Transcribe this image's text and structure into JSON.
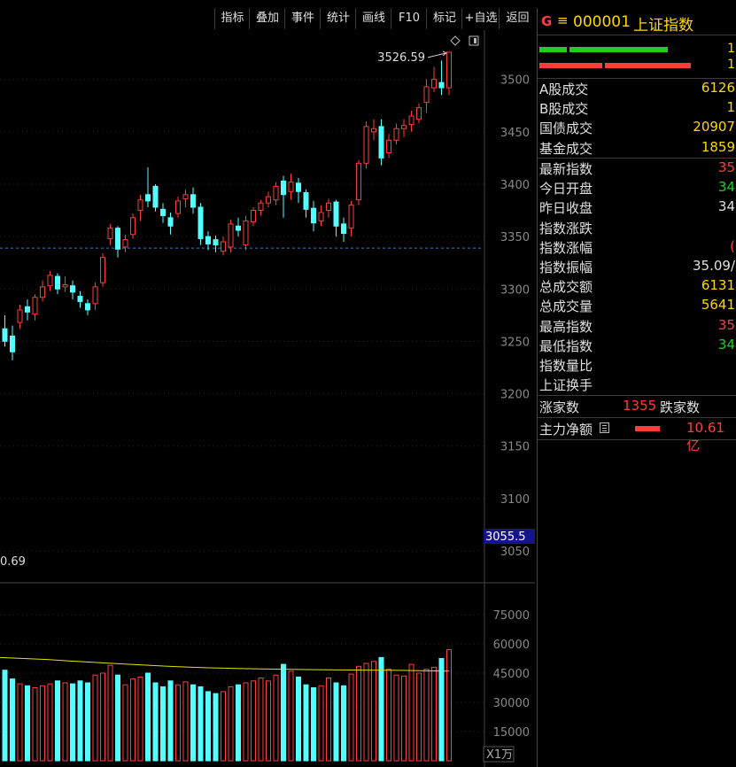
{
  "toolbar": {
    "buttons": [
      {
        "label": "指标"
      },
      {
        "label": "叠加"
      },
      {
        "label": "事件"
      },
      {
        "label": "统计"
      },
      {
        "label": "画线"
      },
      {
        "label": "F10"
      },
      {
        "label": "标记"
      },
      {
        "label": "+自选"
      },
      {
        "label": "返回"
      }
    ]
  },
  "header": {
    "badge": "G",
    "menu_glyph": "≡",
    "code": "000001",
    "name": "上证指数"
  },
  "colors": {
    "up": "#ff3d3d",
    "down": "#54ffff",
    "accent": "#ffd700",
    "green": "#22cc22",
    "ma": "#e3e300"
  },
  "side": {
    "top_digits": [
      "1",
      "1"
    ],
    "turnover": [
      {
        "label": "A股成交",
        "value": "6126",
        "color": "#ffd700"
      },
      {
        "label": "B股成交",
        "value": "1",
        "color": "#ffd700"
      },
      {
        "label": "国债成交",
        "value": "20907",
        "color": "#ffd700"
      },
      {
        "label": "基金成交",
        "value": "1859",
        "color": "#ffd700"
      }
    ],
    "index_info": [
      {
        "label": "最新指数",
        "value": "35",
        "color": "#ff3d3d"
      },
      {
        "label": "今日开盘",
        "value": "34",
        "color": "#22cc22"
      },
      {
        "label": "昨日收盘",
        "value": "34",
        "color": "#e0e0e0"
      },
      {
        "label": "指数涨跌",
        "value": "",
        "color": "#ff3d3d"
      },
      {
        "label": "指数涨幅",
        "value": "(",
        "color": "#ff3d3d"
      },
      {
        "label": "指数振幅",
        "value": "35.09/",
        "color": "#e0e0e0"
      },
      {
        "label": "总成交额",
        "value": "6131",
        "color": "#ffd700"
      },
      {
        "label": "总成交量",
        "value": "5641",
        "color": "#ffd700"
      },
      {
        "label": "最高指数",
        "value": "35",
        "color": "#ff3d3d"
      },
      {
        "label": "最低指数",
        "value": "34",
        "color": "#22cc22"
      },
      {
        "label": "指数量比",
        "value": "",
        "color": "#e0e0e0"
      },
      {
        "label": "上证换手",
        "value": "",
        "color": "#e0e0e0"
      }
    ],
    "breadth": {
      "up_label": "涨家数",
      "up_count": "1355",
      "down_label": "跌家数"
    },
    "mainforce": {
      "label": "主力净额",
      "value": "10.61亿"
    }
  },
  "chart_data": {
    "type": "candlestick",
    "y_axis": {
      "ticks": [
        3050,
        3100,
        3150,
        3200,
        3250,
        3300,
        3350,
        3400,
        3450,
        3500
      ]
    },
    "price_marker": "3055.5",
    "reference_line": 3339,
    "high_annotation": "3526.59",
    "low_annotation_fragment": "0.69",
    "volume_axis": {
      "unit_label": "X1万",
      "ticks": [
        15000,
        30000,
        45000,
        60000,
        75000
      ]
    },
    "candles": [
      [
        3262,
        3250,
        3275,
        3245
      ],
      [
        3255,
        3240,
        3265,
        3232
      ],
      [
        3268,
        3280,
        3285,
        3262
      ],
      [
        3283,
        3278,
        3290,
        3270
      ],
      [
        3276,
        3292,
        3295,
        3270
      ],
      [
        3292,
        3302,
        3308,
        3288
      ],
      [
        3303,
        3313,
        3317,
        3298
      ],
      [
        3312,
        3300,
        3315,
        3295
      ],
      [
        3302,
        3304,
        3312,
        3297
      ],
      [
        3303,
        3297,
        3308,
        3290
      ],
      [
        3293,
        3288,
        3298,
        3282
      ],
      [
        3286,
        3280,
        3290,
        3275
      ],
      [
        3286,
        3302,
        3306,
        3280
      ],
      [
        3306,
        3330,
        3334,
        3302
      ],
      [
        3348,
        3358,
        3362,
        3342
      ],
      [
        3358,
        3338,
        3360,
        3330
      ],
      [
        3340,
        3347,
        3352,
        3335
      ],
      [
        3352,
        3368,
        3372,
        3348
      ],
      [
        3375,
        3385,
        3390,
        3365
      ],
      [
        3390,
        3384,
        3416,
        3378
      ],
      [
        3398,
        3378,
        3400,
        3374
      ],
      [
        3376,
        3370,
        3382,
        3363
      ],
      [
        3368,
        3360,
        3373,
        3352
      ],
      [
        3372,
        3384,
        3388,
        3368
      ],
      [
        3386,
        3390,
        3395,
        3378
      ],
      [
        3390,
        3378,
        3397,
        3372
      ],
      [
        3378,
        3348,
        3382,
        3342
      ],
      [
        3350,
        3343,
        3355,
        3337
      ],
      [
        3347,
        3342,
        3351,
        3335
      ],
      [
        3336,
        3345,
        3350,
        3332
      ],
      [
        3340,
        3362,
        3366,
        3335
      ],
      [
        3360,
        3356,
        3368,
        3350
      ],
      [
        3342,
        3365,
        3370,
        3337
      ],
      [
        3364,
        3375,
        3378,
        3360
      ],
      [
        3375,
        3382,
        3385,
        3370
      ],
      [
        3382,
        3388,
        3393,
        3378
      ],
      [
        3385,
        3398,
        3402,
        3380
      ],
      [
        3403,
        3390,
        3408,
        3368
      ],
      [
        3393,
        3402,
        3410,
        3385
      ],
      [
        3401,
        3393,
        3406,
        3382
      ],
      [
        3392,
        3376,
        3395,
        3368
      ],
      [
        3377,
        3363,
        3384,
        3355
      ],
      [
        3365,
        3373,
        3380,
        3360
      ],
      [
        3375,
        3382,
        3386,
        3368
      ],
      [
        3383,
        3360,
        3385,
        3350
      ],
      [
        3362,
        3353,
        3368,
        3345
      ],
      [
        3358,
        3380,
        3384,
        3350
      ],
      [
        3385,
        3420,
        3423,
        3380
      ],
      [
        3420,
        3455,
        3460,
        3415
      ],
      [
        3450,
        3453,
        3462,
        3442
      ],
      [
        3455,
        3425,
        3462,
        3418
      ],
      [
        3430,
        3442,
        3448,
        3425
      ],
      [
        3442,
        3453,
        3458,
        3438
      ],
      [
        3453,
        3456,
        3462,
        3445
      ],
      [
        3457,
        3465,
        3470,
        3450
      ],
      [
        3462,
        3473,
        3477,
        3458
      ],
      [
        3478,
        3493,
        3500,
        3468
      ],
      [
        3492,
        3500,
        3512,
        3488
      ],
      [
        3497,
        3492,
        3518,
        3485
      ],
      [
        3492,
        3526,
        3526,
        3485
      ]
    ],
    "volumes": [
      46500,
      42000,
      39500,
      38500,
      37500,
      38500,
      39500,
      41000,
      40000,
      39500,
      41000,
      40000,
      44000,
      45000,
      49000,
      44000,
      39000,
      42000,
      43000,
      45000,
      40000,
      38000,
      41000,
      39000,
      40500,
      39000,
      38000,
      35500,
      34500,
      35500,
      38000,
      39000,
      40000,
      41000,
      42500,
      41000,
      44000,
      49500,
      46000,
      43000,
      39000,
      37500,
      38500,
      42500,
      40000,
      38500,
      44500,
      48500,
      50000,
      51000,
      53000,
      47000,
      44000,
      43500,
      49500,
      45000,
      47000,
      48000,
      52500,
      57000
    ],
    "ma_volume": [
      53000,
      52500,
      52000,
      51200,
      50500,
      49800,
      49200,
      48600,
      48100,
      47700,
      47400,
      47200,
      47000,
      46800,
      46700,
      46600,
      46500,
      46400,
      46200,
      46000
    ]
  }
}
